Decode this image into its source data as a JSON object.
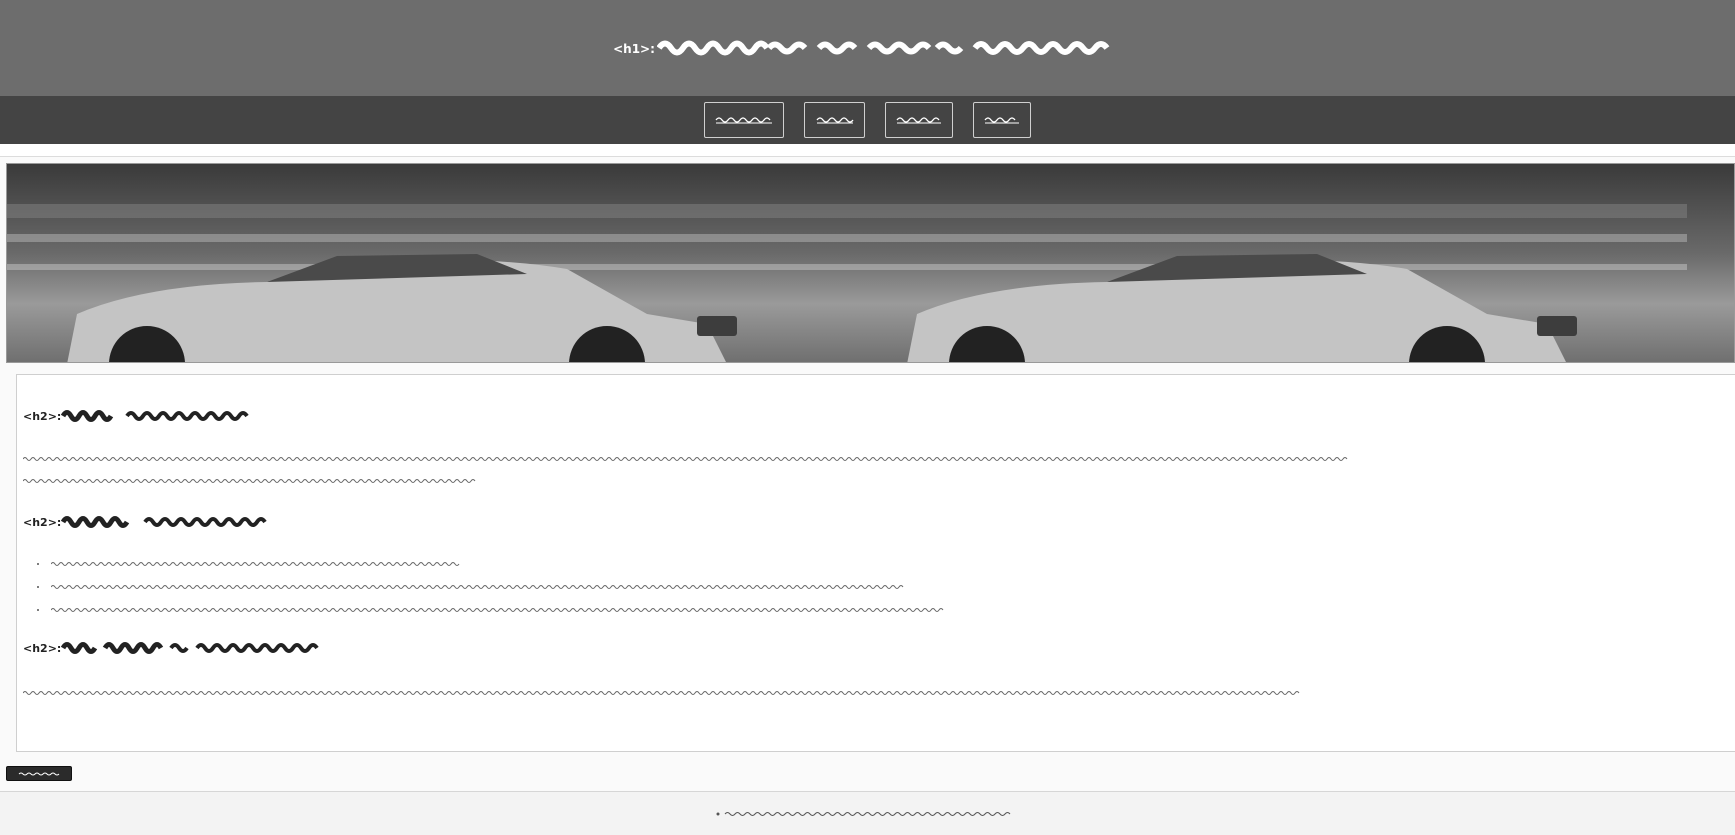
{
  "header": {
    "tag_prefix": "<h1>:"
  },
  "content": {
    "sections": [
      {
        "tag_prefix": "<h2>:"
      },
      {
        "tag_prefix": "<h2>:"
      },
      {
        "tag_prefix": "<h2>:"
      }
    ]
  },
  "colors": {
    "header_bg": "#6d6d6d",
    "nav_bg": "#444444",
    "footer_bg": "#f3f3f3"
  }
}
